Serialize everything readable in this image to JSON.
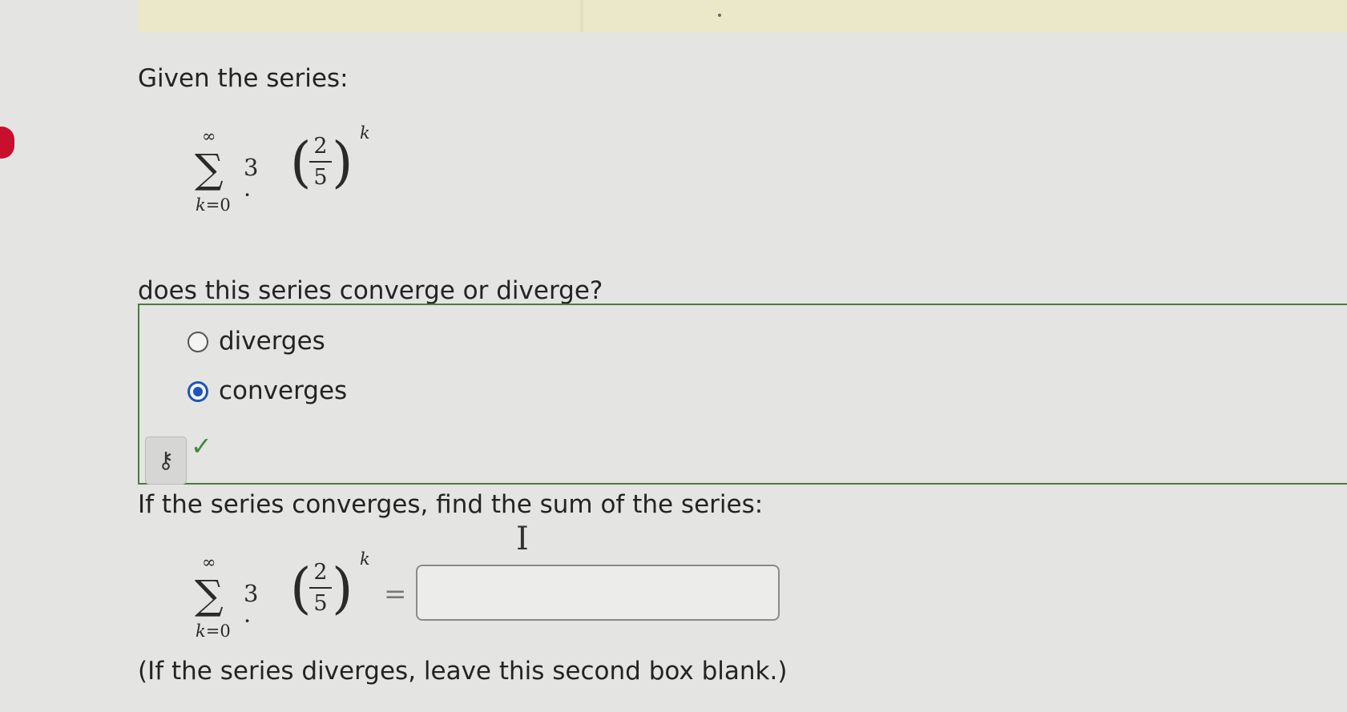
{
  "question": {
    "intro": "Given the series:",
    "series": {
      "sum_upper": "∞",
      "sum_lower_var": "k",
      "sum_lower_rest": "=0",
      "coefficient": "3 ·",
      "numerator": "2",
      "denominator": "5",
      "exponent": "k"
    },
    "part1_prompt": "does this series converge or diverge?",
    "options": [
      {
        "label": "diverges",
        "selected": false
      },
      {
        "label": "converges",
        "selected": true
      }
    ],
    "key_icon_glyph": "⚷",
    "check_glyph": "✓",
    "part2_prompt": "If the series converges, find the sum of the series:",
    "equals": "=",
    "answer_value": "",
    "blank_note": "(If the series diverges, leave this second box blank.)"
  },
  "colors": {
    "selected_radio": "#1f55b5",
    "correct_check": "#3d8b3d",
    "panel_border": "#4c7a3f"
  }
}
